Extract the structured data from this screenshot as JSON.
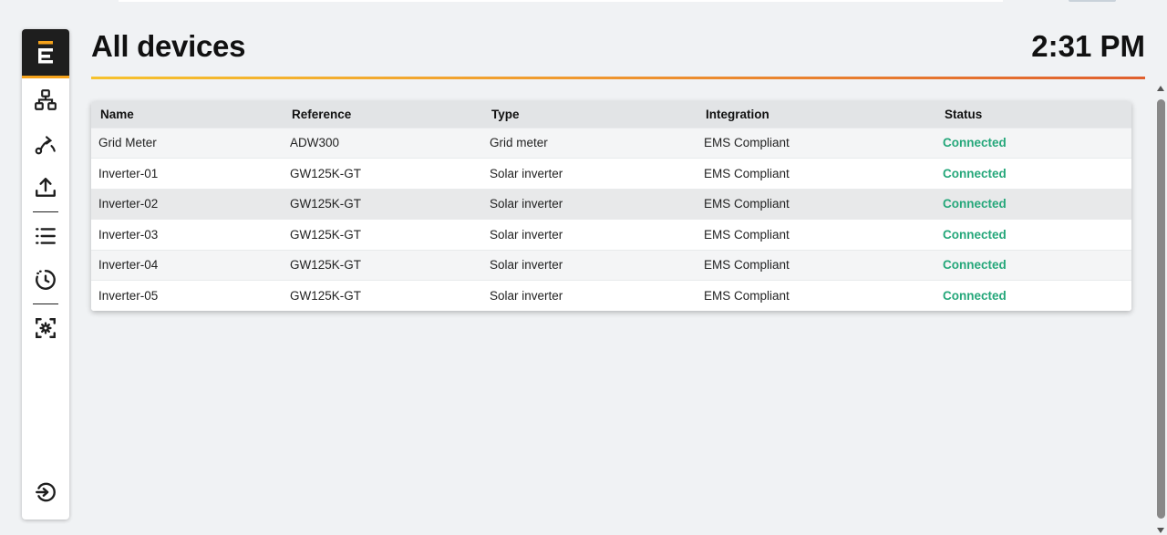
{
  "header": {
    "title": "All devices",
    "clock": "2:31 PM"
  },
  "sidebar": {
    "items": [
      {
        "name": "topology",
        "icon": "network-icon"
      },
      {
        "name": "route",
        "icon": "route-icon"
      },
      {
        "name": "upload",
        "icon": "upload-icon"
      },
      {
        "name": "list",
        "icon": "list-icon"
      },
      {
        "name": "history",
        "icon": "clock-history-icon"
      },
      {
        "name": "scan",
        "icon": "scan-icon"
      }
    ],
    "bottom_item": {
      "name": "logout",
      "icon": "logout-icon"
    }
  },
  "table": {
    "columns": [
      "Name",
      "Reference",
      "Type",
      "Integration",
      "Status"
    ],
    "rows": [
      {
        "name": "Grid Meter",
        "reference": "ADW300",
        "type": "Grid meter",
        "integration": "EMS Compliant",
        "status": "Connected"
      },
      {
        "name": "Inverter-01",
        "reference": "GW125K-GT",
        "type": "Solar inverter",
        "integration": "EMS Compliant",
        "status": "Connected"
      },
      {
        "name": "Inverter-02",
        "reference": "GW125K-GT",
        "type": "Solar inverter",
        "integration": "EMS Compliant",
        "status": "Connected"
      },
      {
        "name": "Inverter-03",
        "reference": "GW125K-GT",
        "type": "Solar inverter",
        "integration": "EMS Compliant",
        "status": "Connected"
      },
      {
        "name": "Inverter-04",
        "reference": "GW125K-GT",
        "type": "Solar inverter",
        "integration": "EMS Compliant",
        "status": "Connected"
      },
      {
        "name": "Inverter-05",
        "reference": "GW125K-GT",
        "type": "Solar inverter",
        "integration": "EMS Compliant",
        "status": "Connected"
      }
    ]
  },
  "colors": {
    "status_connected": "#25a77a",
    "accent_orange": "#f5a21b",
    "sidebar_dark": "#1e1e1e"
  }
}
